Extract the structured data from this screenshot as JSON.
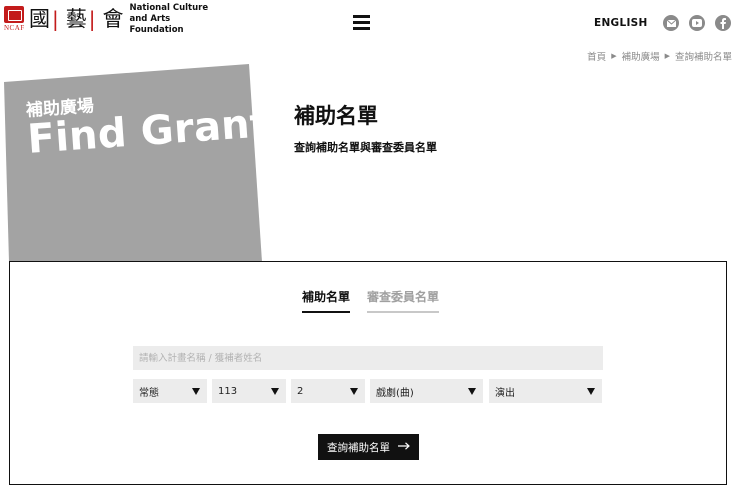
{
  "header": {
    "logo": {
      "abbr": "NCAF",
      "glyphs": [
        "國",
        "|",
        "藝",
        "|",
        "會"
      ],
      "name_line1": "National Culture",
      "name_line2": "and Arts Foundation"
    },
    "menu_icon": "hamburger-icon",
    "language_link": "ENGLISH",
    "social": [
      "mail-icon",
      "youtube-icon",
      "facebook-icon"
    ]
  },
  "breadcrumb": {
    "items": [
      "首頁",
      "補助廣場",
      "查詢補助名單"
    ],
    "separator": "▶"
  },
  "hero": {
    "subtitle": "補助廣場",
    "title": "Find Grants"
  },
  "page": {
    "title": "補助名單",
    "description": "查詢補助名單與審查委員名單"
  },
  "search": {
    "tabs": [
      {
        "label": "補助名單",
        "active": true
      },
      {
        "label": "審查委員名單",
        "active": false
      }
    ],
    "placeholder": "請輸入計畫名稱 / 獲補者姓名",
    "filters": [
      "常態",
      "113",
      "2",
      "戲劇(曲)",
      "演出"
    ],
    "submit_label": "查詢補助名單"
  },
  "colors": {
    "brand_red": "#c31b1b",
    "hero_gray": "#a3a3a3",
    "field_bg": "#ececec",
    "icon_gray": "#8a8a8a"
  }
}
